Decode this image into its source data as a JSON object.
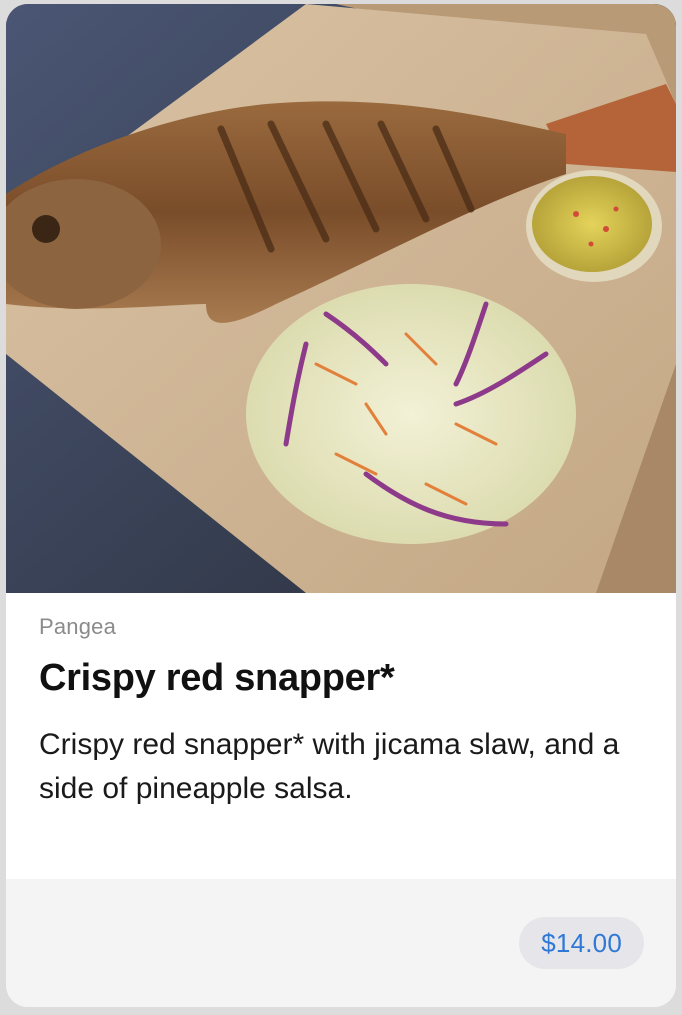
{
  "item": {
    "restaurant": "Pangea",
    "name": "Crispy red snapper*",
    "description": "Crispy red snapper* with jicama slaw, and a side of pineapple salsa.",
    "price": "$14.00"
  },
  "colors": {
    "price_text": "#2f78d6",
    "price_pill_bg": "#e6e6ea",
    "footer_bg": "#f4f4f5",
    "muted_text": "#8b8b8b"
  }
}
